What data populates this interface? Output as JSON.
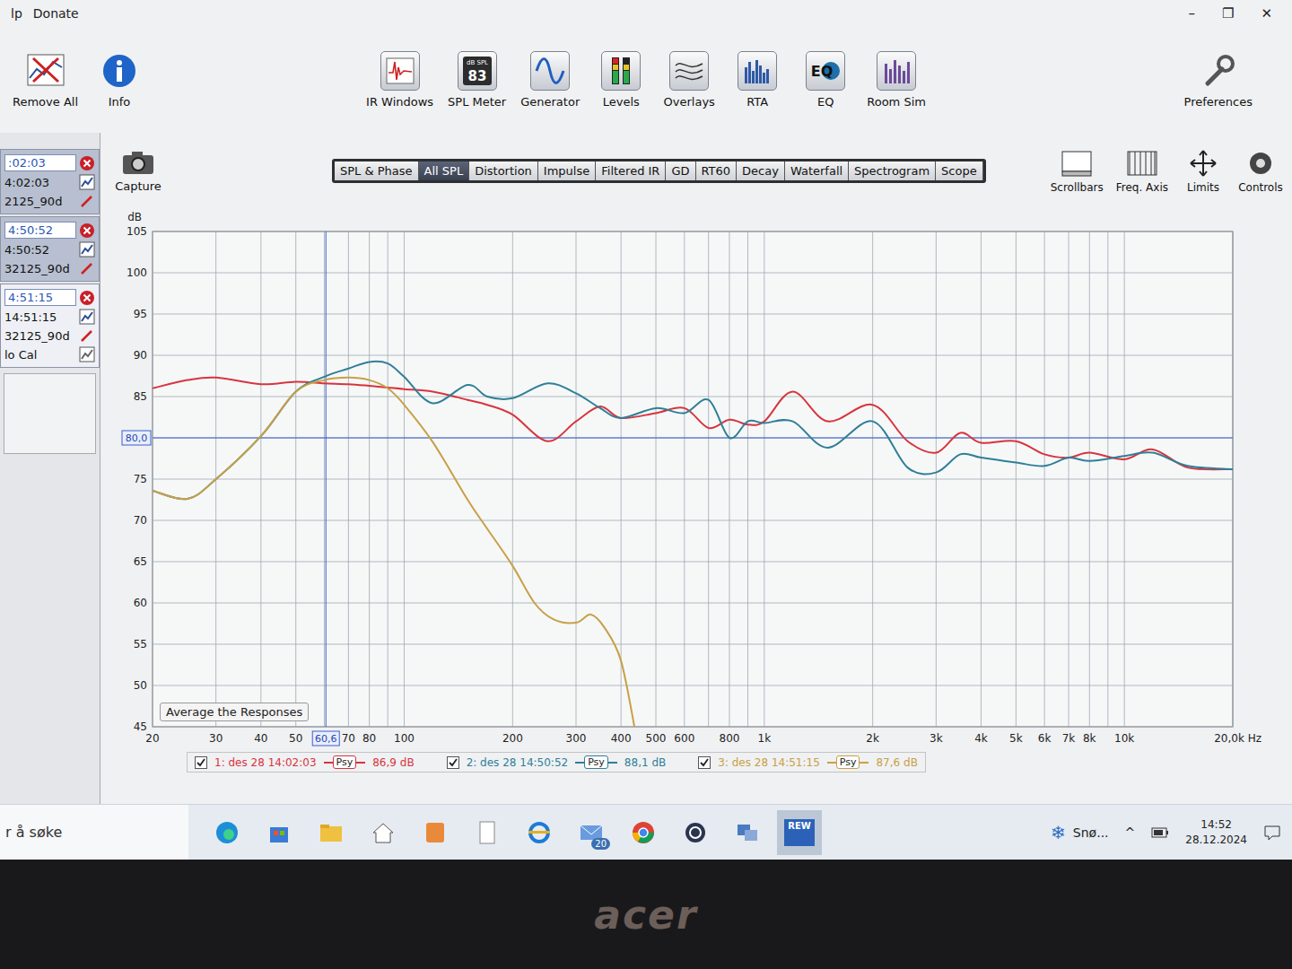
{
  "window": {
    "menu": [
      "lp",
      "Donate"
    ],
    "controls": [
      "–",
      "❐",
      "✕"
    ]
  },
  "toolbar_left": [
    {
      "label": "Remove All"
    },
    {
      "label": "Info"
    }
  ],
  "tools": [
    {
      "label": "IR Windows",
      "icon_text": []
    },
    {
      "label": "SPL Meter",
      "icon_text": [
        "dB SPL",
        "83"
      ]
    },
    {
      "label": "Generator",
      "icon_text": []
    },
    {
      "label": "Levels",
      "icon_text": []
    },
    {
      "label": "Overlays",
      "icon_text": []
    },
    {
      "label": "RTA",
      "icon_text": []
    },
    {
      "label": "EQ",
      "icon_text": [
        "EQ"
      ]
    },
    {
      "label": "Room Sim",
      "icon_text": []
    }
  ],
  "preferences": "Preferences",
  "capture": "Capture",
  "measurements": [
    {
      "field": ":02:03",
      "time": "4:02:03",
      "name": "2125_90d",
      "selected": false
    },
    {
      "field": "4:50:52",
      "time": "4:50:52",
      "name": "32125_90d",
      "selected": false
    },
    {
      "field": "4:51:15",
      "time": "14:51:15",
      "name": "32125_90d",
      "note": "lo Cal",
      "selected": true
    }
  ],
  "tabs": [
    {
      "label": "SPL & Phase",
      "selected": false
    },
    {
      "label": "All SPL",
      "selected": true
    },
    {
      "label": "Distortion",
      "selected": false
    },
    {
      "label": "Impulse",
      "selected": false
    },
    {
      "label": "Filtered IR",
      "selected": false
    },
    {
      "label": "GD",
      "selected": false
    },
    {
      "label": "RT60",
      "selected": false
    },
    {
      "label": "Decay",
      "selected": false
    },
    {
      "label": "Waterfall",
      "selected": false
    },
    {
      "label": "Spectrogram",
      "selected": false
    },
    {
      "label": "Scope",
      "selected": false
    }
  ],
  "view_controls": [
    "Scrollbars",
    "Freq. Axis",
    "Limits",
    "Controls"
  ],
  "chart": {
    "y_unit": "dB",
    "y_min": 45,
    "y_max": 105,
    "x_min_hz": 20,
    "x_max_hz": 20000,
    "y_ticks": [
      {
        "label": "105",
        "value": 105
      },
      {
        "label": "100",
        "value": 100
      },
      {
        "label": "95",
        "value": 95
      },
      {
        "label": "90",
        "value": 90
      },
      {
        "label": "85",
        "value": 85
      },
      {
        "label": "75",
        "value": 75
      },
      {
        "label": "70",
        "value": 70
      },
      {
        "label": "65",
        "value": 65
      },
      {
        "label": "60",
        "value": 60
      },
      {
        "label": "55",
        "value": 55
      },
      {
        "label": "50",
        "value": 50
      },
      {
        "label": "45",
        "value": 45
      }
    ],
    "x_ticks": [
      {
        "label": "20",
        "hz": 20
      },
      {
        "label": "30",
        "hz": 30
      },
      {
        "label": "40",
        "hz": 40
      },
      {
        "label": "50",
        "hz": 50
      },
      {
        "label": "70",
        "hz": 70
      },
      {
        "label": "80",
        "hz": 80
      },
      {
        "label": "100",
        "hz": 100
      },
      {
        "label": "200",
        "hz": 200
      },
      {
        "label": "300",
        "hz": 300
      },
      {
        "label": "400",
        "hz": 400
      },
      {
        "label": "500",
        "hz": 500
      },
      {
        "label": "600",
        "hz": 600
      },
      {
        "label": "800",
        "hz": 800
      },
      {
        "label": "1k",
        "hz": 1000
      },
      {
        "label": "2k",
        "hz": 2000
      },
      {
        "label": "3k",
        "hz": 3000
      },
      {
        "label": "4k",
        "hz": 4000
      },
      {
        "label": "5k",
        "hz": 5000
      },
      {
        "label": "6k",
        "hz": 6000
      },
      {
        "label": "7k",
        "hz": 7000
      },
      {
        "label": "8k",
        "hz": 8000
      },
      {
        "label": "10k",
        "hz": 10000
      },
      {
        "label": "20,0k Hz",
        "hz": 20000
      }
    ],
    "cursor": {
      "x_label": "60,6",
      "x_hz": 60.6,
      "y_label": "80,0",
      "y_value": 80
    },
    "average_button": "Average the Responses",
    "series": [
      {
        "label": "1: des 28 14:02:03",
        "checked": true,
        "badge": "Psy",
        "reading": "86,9 dB",
        "color": "#d8343d",
        "freqs_hz": [
          20,
          25,
          30,
          40,
          50,
          60,
          70,
          80,
          90,
          100,
          120,
          150,
          170,
          200,
          250,
          300,
          350,
          400,
          500,
          600,
          700,
          800,
          900,
          1000,
          1200,
          1500,
          2000,
          2500,
          3000,
          3500,
          4000,
          5000,
          6000,
          7000,
          8000,
          10000,
          12000,
          15000,
          20000
        ],
        "values_db": [
          86,
          87,
          87.3,
          86.5,
          86.8,
          86.6,
          86.5,
          86.3,
          86.1,
          85.9,
          85.6,
          84.6,
          84,
          82.8,
          79.6,
          82,
          83.8,
          82.4,
          83,
          83.6,
          81.2,
          82.2,
          81.6,
          82,
          85.6,
          82,
          84,
          79.6,
          78.2,
          80.6,
          79.4,
          79.6,
          78,
          77.6,
          78.2,
          77.4,
          78.6,
          76.4,
          76.2
        ]
      },
      {
        "label": "2: des 28 14:50:52",
        "checked": true,
        "badge": "Psy",
        "reading": "88,1 dB",
        "color": "#2f7f98",
        "freqs_hz": [
          20,
          25,
          30,
          40,
          50,
          60,
          70,
          80,
          90,
          100,
          120,
          150,
          170,
          200,
          250,
          300,
          350,
          400,
          500,
          600,
          700,
          800,
          900,
          1000,
          1200,
          1500,
          2000,
          2500,
          3000,
          3500,
          4000,
          5000,
          6000,
          7000,
          8000,
          10000,
          12000,
          15000,
          20000
        ],
        "values_db": [
          73.6,
          72.6,
          75,
          80.2,
          85.6,
          87.4,
          88.4,
          89.2,
          89,
          87.4,
          84.2,
          86.4,
          85,
          84.8,
          86.6,
          85.4,
          83.6,
          82.4,
          83.6,
          83,
          84.6,
          80,
          82,
          81.8,
          82,
          78.8,
          82,
          76.4,
          75.8,
          78,
          77.6,
          77,
          76.6,
          77.6,
          77.2,
          77.8,
          78.2,
          76.6,
          76.2
        ]
      },
      {
        "label": "3: des 28 14:51:15",
        "checked": true,
        "badge": "Psy",
        "reading": "87,6 dB",
        "color": "#c8a046",
        "freqs_hz": [
          20,
          25,
          30,
          40,
          50,
          60,
          70,
          80,
          90,
          100,
          120,
          150,
          170,
          200,
          230,
          260,
          300,
          330,
          360,
          400,
          440
        ],
        "values_db": [
          73.6,
          72.6,
          75,
          80.2,
          85.6,
          87,
          87.3,
          87,
          86,
          84,
          79.5,
          72.5,
          69,
          64.5,
          60,
          58,
          57.6,
          58.6,
          57,
          53,
          44
        ]
      }
    ]
  },
  "taskbar": {
    "search": "r å søke",
    "mail_badge": "20",
    "rew_label": "REW",
    "weather_icon": "❄",
    "weather": "Snø...",
    "tray_caret": "^",
    "time": "14:52",
    "date": "28.12.2024"
  },
  "bezel": {
    "logo": "acer"
  }
}
